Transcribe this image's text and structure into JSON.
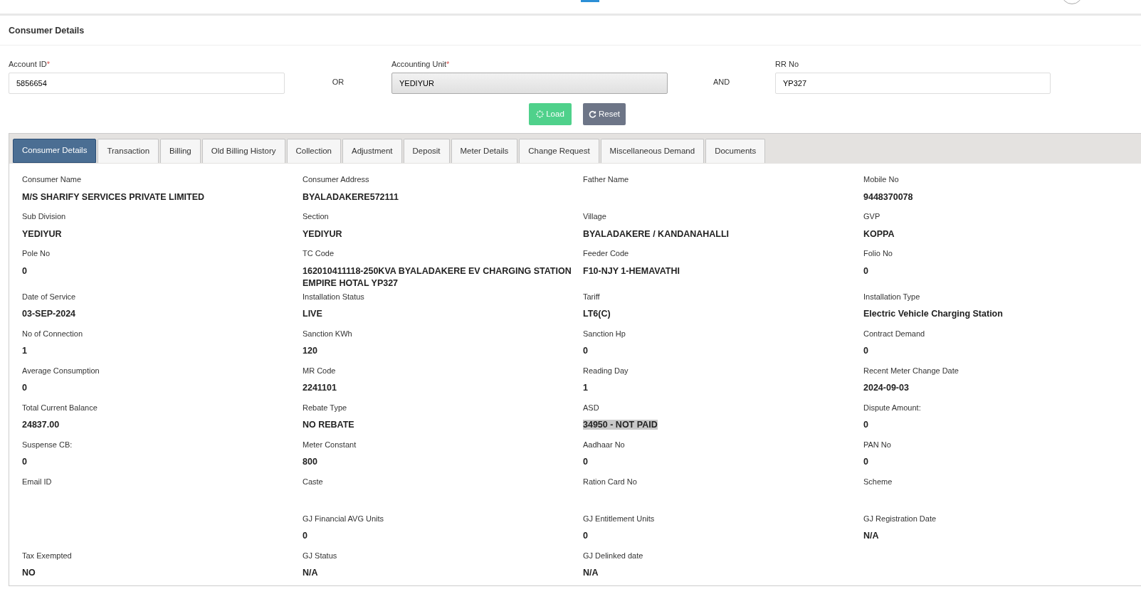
{
  "page_title": "Consumer Details",
  "search": {
    "fields": [
      {
        "label": "Account ID",
        "required_mark": "*",
        "value": "5856654",
        "kind": "input"
      },
      {
        "label": "Accounting Unit",
        "required_mark": "*",
        "value": "YEDIYUR",
        "kind": "select"
      },
      {
        "label": "RR No",
        "value": "YP327",
        "kind": "input"
      }
    ],
    "connectors": [
      "OR",
      "AND"
    ],
    "buttons": [
      {
        "label": "Load",
        "kind": "load"
      },
      {
        "label": "Reset",
        "kind": "reset"
      }
    ]
  },
  "tabs": [
    {
      "label": "Consumer Details",
      "selected": true
    },
    {
      "label": "Transaction",
      "selected": false
    },
    {
      "label": "Billing",
      "selected": false
    },
    {
      "label": "Old Billing History",
      "selected": false
    },
    {
      "label": "Collection",
      "selected": false
    },
    {
      "label": "Adjustment",
      "selected": false
    },
    {
      "label": "Deposit",
      "selected": false
    },
    {
      "label": "Meter Details",
      "selected": false
    },
    {
      "label": "Change Request",
      "selected": false
    },
    {
      "label": "Miscellaneous Demand",
      "selected": false
    },
    {
      "label": "Documents",
      "selected": false
    }
  ],
  "details": [
    [
      {
        "label": "Consumer Name",
        "value": "M/S SHARIFY SERVICES PRIVATE LIMITED"
      },
      {
        "label": "Consumer Address",
        "value": "BYALADAKERE572111"
      },
      {
        "label": "Father Name"
      },
      {
        "label": "Mobile No",
        "value": "9448370078"
      }
    ],
    [
      {
        "label": "Sub Division",
        "value": "YEDIYUR"
      },
      {
        "label": "Section",
        "value": "YEDIYUR"
      },
      {
        "label": "Village",
        "value": "BYALADAKERE / KANDANAHALLI"
      },
      {
        "label": "GVP",
        "value": "KOPPA"
      }
    ],
    [
      {
        "label": "Pole No",
        "value": "0"
      },
      {
        "label": "TC Code",
        "value": "162010411118-250KVA BYALADAKERE EV CHARGING STATION EMPIRE HOTAL YP327"
      },
      {
        "label": "Feeder Code",
        "value": "F10-NJY 1-HEMAVATHI"
      },
      {
        "label": "Folio No",
        "value": "0"
      }
    ],
    [
      {
        "label": "Date of Service",
        "value": "03-SEP-2024"
      },
      {
        "label": "Installation Status",
        "value": "LIVE"
      },
      {
        "label": "Tariff",
        "value": "LT6(C)"
      },
      {
        "label": "Installation Type",
        "value": "Electric Vehicle Charging Station"
      }
    ],
    [
      {
        "label": "No of Connection",
        "value": "1"
      },
      {
        "label": "Sanction KWh",
        "value": "120"
      },
      {
        "label": "Sanction Hp",
        "value": "0"
      },
      {
        "label": "Contract Demand",
        "value": "0"
      }
    ],
    [
      {
        "label": "Average Consumption",
        "value": "0"
      },
      {
        "label": "MR Code",
        "value": "2241101"
      },
      {
        "label": "Reading Day",
        "value": "1"
      },
      {
        "label": "Recent Meter Change Date",
        "value": "2024-09-03"
      }
    ],
    [
      {
        "label": "Total Current Balance",
        "value": "24837.00"
      },
      {
        "label": "Rebate Type",
        "value": "NO REBATE"
      },
      {
        "label": "ASD",
        "value": "34950 - NOT PAID",
        "highlighted": true
      },
      {
        "label": "Dispute Amount:",
        "value": "0"
      }
    ],
    [
      {
        "label": "Suspense CB:",
        "value": "0"
      },
      {
        "label": "Meter Constant",
        "value": "800"
      },
      {
        "label": "Aadhaar No",
        "value": "0"
      },
      {
        "label": "PAN No",
        "value": "0"
      }
    ],
    [
      {
        "label": "Email ID"
      },
      {
        "label": "Caste"
      },
      {
        "label": "Ration Card No"
      },
      {
        "label": "Scheme"
      }
    ],
    {
      "first_column_empty": true,
      "cells": [
        {
          "label": "GJ Financial AVG Units",
          "value": "0"
        },
        {
          "label": "GJ Entitlement Units",
          "value": "0"
        },
        {
          "label": "GJ Registration Date",
          "value": "N/A"
        }
      ]
    },
    [
      {
        "label": "Tax Exempted",
        "value": "NO"
      },
      {
        "label": "GJ Status",
        "value": "N/A"
      },
      {
        "label": "GJ Delinked date",
        "value": "N/A"
      }
    ]
  ]
}
